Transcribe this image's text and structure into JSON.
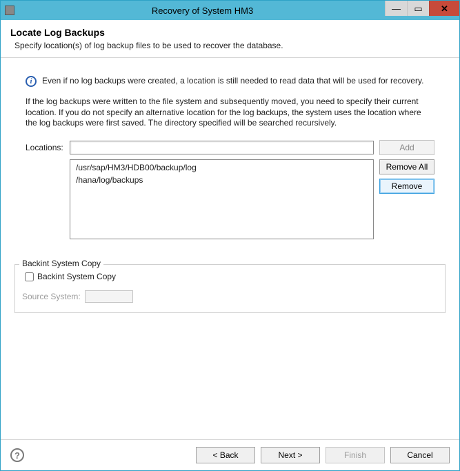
{
  "window": {
    "title": "Recovery of System HM3"
  },
  "header": {
    "title": "Locate Log Backups",
    "subtitle": "Specify location(s) of log backup files to be used to recover the database."
  },
  "info": {
    "text": "Even if no log backups were created, a location is still needed to read data that will be used for recovery."
  },
  "paragraph": "If the log backups were written to the file system and subsequently moved, you need to specify their current location. If you do not specify an alternative location for the log backups, the system uses the location where the log backups were first saved. The directory specified will be searched recursively.",
  "locations": {
    "label": "Locations:",
    "input_value": "",
    "items": [
      "/usr/sap/HM3/HDB00/backup/log",
      "/hana/log/backups"
    ],
    "add_label": "Add",
    "remove_all_label": "Remove All",
    "remove_label": "Remove"
  },
  "backint": {
    "group_label": "Backint System Copy",
    "checkbox_label": "Backint System Copy",
    "checked": false,
    "source_label": "Source System:",
    "source_value": ""
  },
  "footer": {
    "back_label": "< Back",
    "next_label": "Next >",
    "finish_label": "Finish",
    "cancel_label": "Cancel"
  }
}
